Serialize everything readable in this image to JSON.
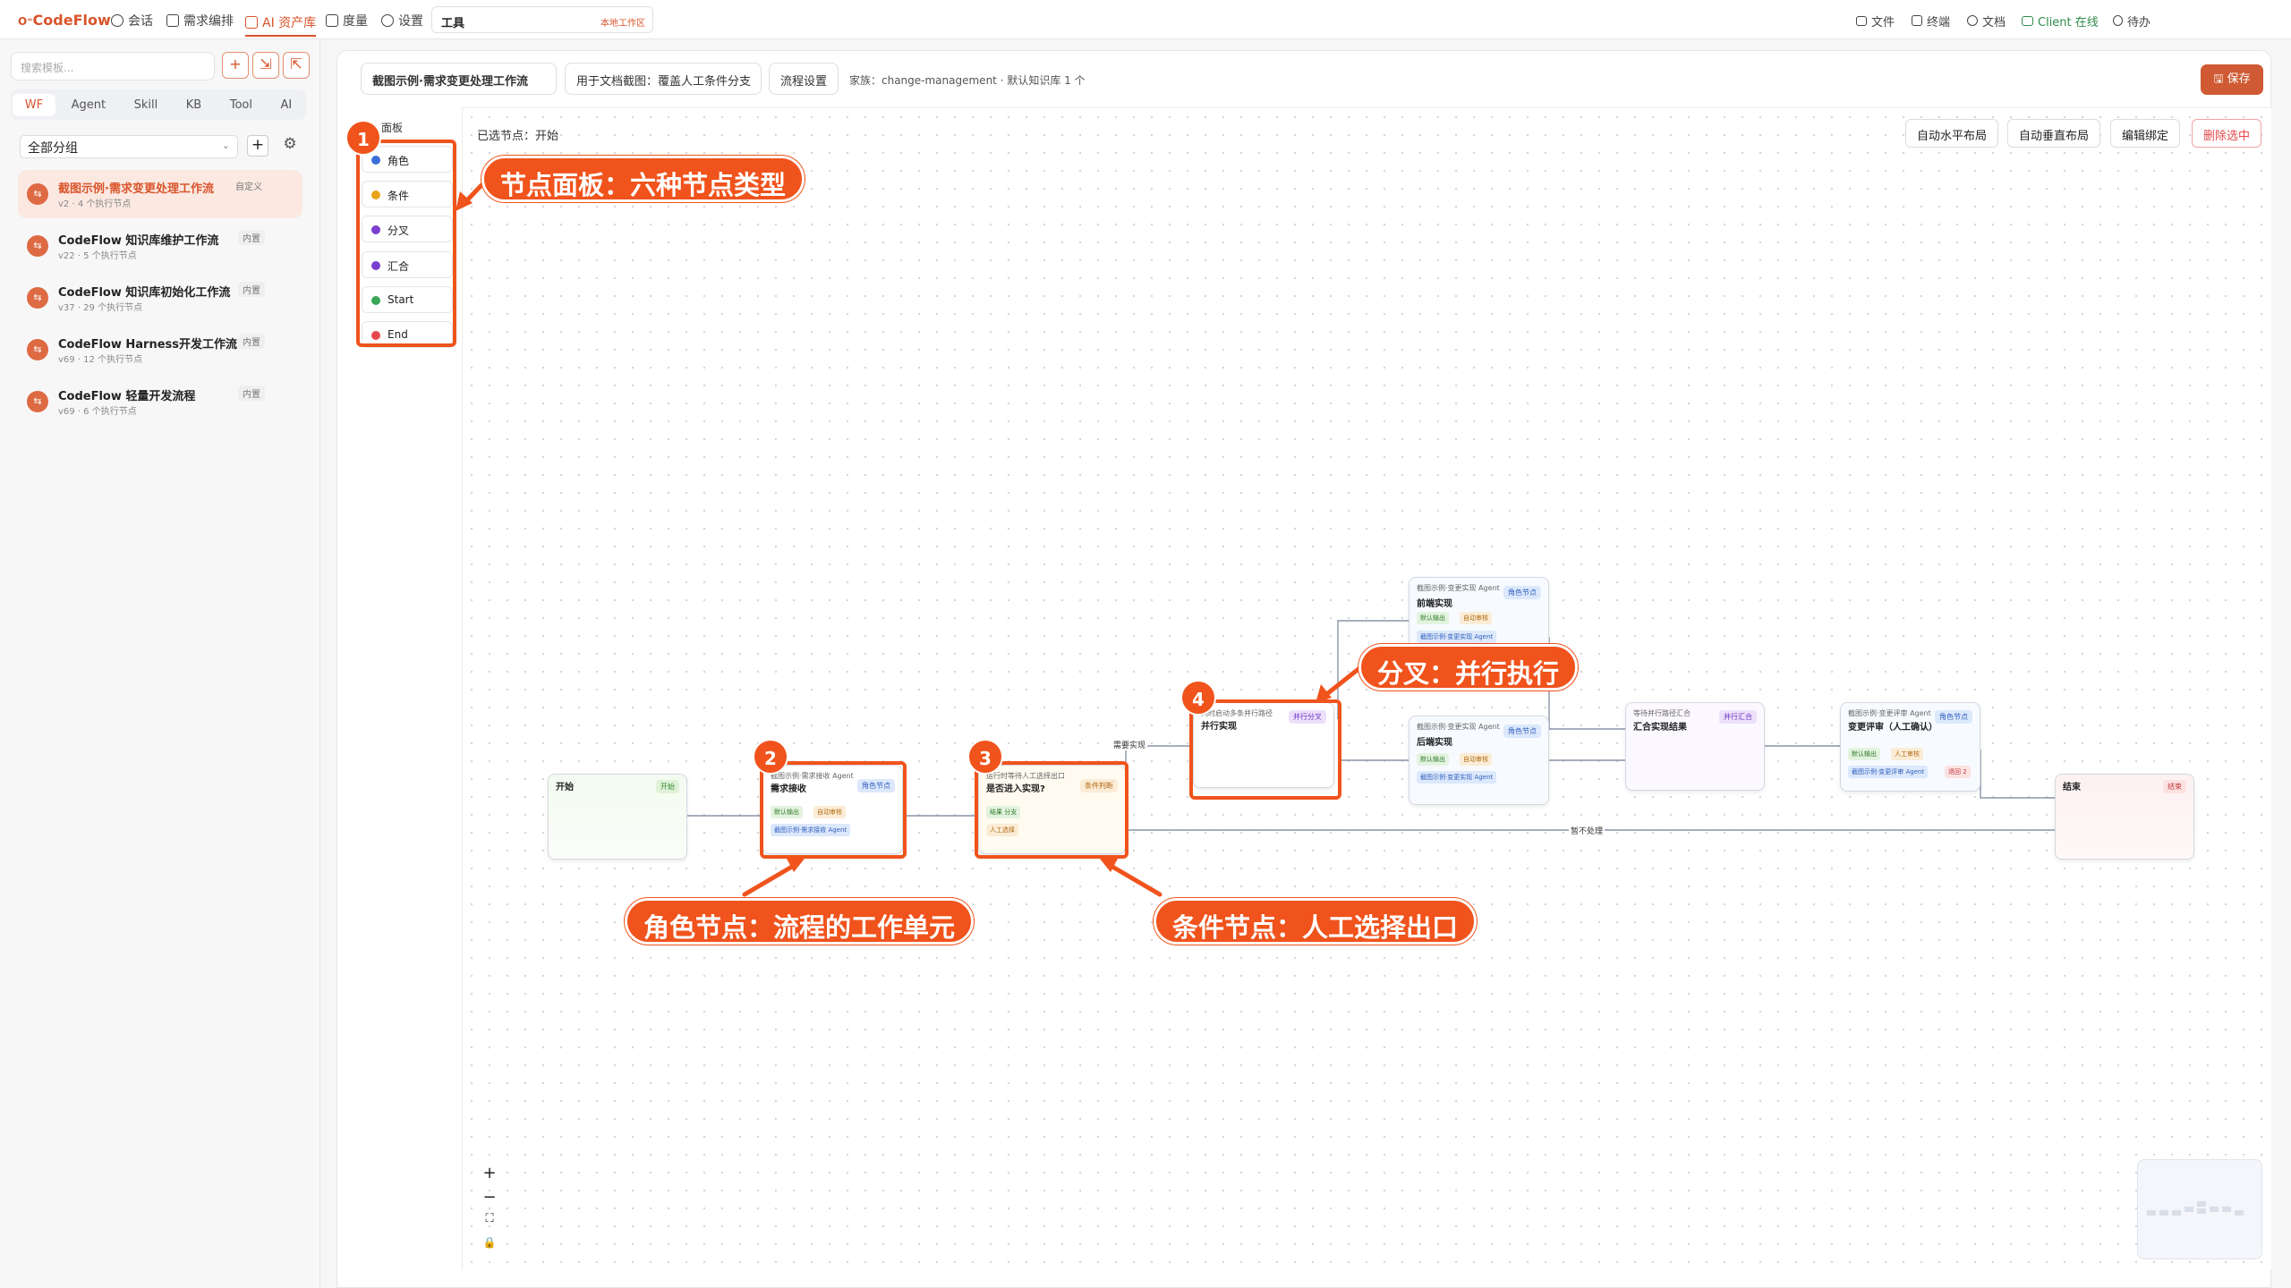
{
  "topbar": {
    "logo": "CodeFlow",
    "nav": [
      "会话",
      "需求编排",
      "AI 资产库",
      "度量",
      "设置"
    ],
    "tool_input": "工具",
    "workspace": "本地工作区",
    "right": [
      "文件",
      "终端",
      "文档",
      "Client 在线",
      "待办"
    ]
  },
  "sidebar": {
    "search_placeholder": "搜索模板...",
    "tabs": [
      "WF",
      "Agent",
      "Skill",
      "KB",
      "Tool",
      "AI"
    ],
    "group": "全部分组",
    "workflows": [
      {
        "title": "截图示例·需求变更处理工作流",
        "sub": "v2 · 4 个执行节点",
        "badge": "自定义"
      },
      {
        "title": "CodeFlow 知识库维护工作流",
        "sub": "v22 · 5 个执行节点",
        "badge": "内置"
      },
      {
        "title": "CodeFlow 知识库初始化工作流",
        "sub": "v37 · 29 个执行节点",
        "badge": "内置"
      },
      {
        "title": "CodeFlow Harness开发工作流",
        "sub": "v69 · 12 个执行节点",
        "badge": "内置"
      },
      {
        "title": "CodeFlow 轻量开发流程",
        "sub": "v69 · 6 个执行节点",
        "badge": "内置"
      }
    ]
  },
  "header": {
    "title": "截图示例·需求变更处理工作流",
    "desc": "用于文档截图：覆盖人工条件分支",
    "settings": "流程设置",
    "family": "家族：change-management · 默认知识库 1 个",
    "save": "保存"
  },
  "toolbar": {
    "selected": "已选节点：开始",
    "buttons": [
      "自动水平布局",
      "自动垂直布局",
      "编辑绑定",
      "删除选中"
    ]
  },
  "palette": {
    "title": "面板",
    "items": [
      {
        "label": "角色",
        "color": "#3b6fd8"
      },
      {
        "label": "条件",
        "color": "#e8a317"
      },
      {
        "label": "分叉",
        "color": "#7a3fd0"
      },
      {
        "label": "汇合",
        "color": "#7a3fd0"
      },
      {
        "label": "Start",
        "color": "#3aa757"
      },
      {
        "label": "End",
        "color": "#e5484d"
      }
    ]
  },
  "nodes": {
    "start": {
      "name": "开始",
      "tag": "开始"
    },
    "req": {
      "kind": "截图示例·需求接收 Agent",
      "name": "需求接收",
      "tag": "角色节点",
      "c1": "默认输出",
      "c2": "自动审核",
      "agent": "截图示例·需求接收 Agent"
    },
    "cond": {
      "kind": "运行时等待人工选择出口",
      "name": "是否进入实现?",
      "tag": "条件判断",
      "c1": "结果 分支",
      "c2": "人工选择"
    },
    "fork": {
      "kind": "同时启动多条并行路径",
      "name": "并行实现",
      "tag": "并行分叉"
    },
    "fe": {
      "kind": "截图示例·变更实现 Agent",
      "name": "前端实现",
      "tag": "角色节点",
      "c1": "默认输出",
      "c2": "自动审核",
      "agent": "截图示例·变更实现 Agent"
    },
    "be": {
      "kind": "截图示例·变更实现 Agent",
      "name": "后端实现",
      "tag": "角色节点",
      "c1": "默认输出",
      "c2": "自动审核",
      "agent": "截图示例·变更实现 Agent"
    },
    "join": {
      "kind": "等待并行路径汇合",
      "name": "汇合实现结果",
      "tag": "并行汇合"
    },
    "review": {
      "kind": "截图示例·变更评审 Agent",
      "name": "变更评审（人工确认）",
      "tag": "角色节点",
      "c1": "默认输出",
      "c2": "人工审核",
      "agent": "截图示例·变更评审 Agent",
      "c3": "退回 2"
    },
    "end": {
      "name": "结束",
      "tag": "结束"
    }
  },
  "edges": {
    "need": "需要实现",
    "skip": "暂不处理"
  },
  "annotations": {
    "n1": "1",
    "n2": "2",
    "n3": "3",
    "n4": "4",
    "c1": "节点面板：六种节点类型",
    "c2": "角色节点：流程的工作单元",
    "c3": "条件节点：人工选择出口",
    "c4": "分叉：并行执行"
  }
}
